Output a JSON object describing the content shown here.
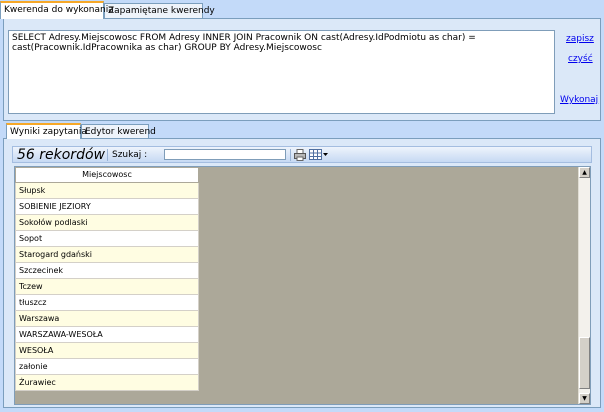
{
  "top_tabs": [
    "Kwerenda do wykonania",
    "Zapamiętane kwerendy"
  ],
  "query": {
    "text": "SELECT Adresy.Miejscowosc FROM Adresy INNER JOIN  Pracownik ON cast(Adresy.IdPodmiotu as char) = cast(Pracownik.IdPracownika as char) GROUP BY  Adresy.Miejscowosc",
    "save_label": "zapisz",
    "clear_label": "czyść",
    "run_label": "Wykonaj"
  },
  "result_tabs": [
    "Wyniki zapytania",
    "Edytor kwerend"
  ],
  "toolbar": {
    "record_count": "56 rekordów",
    "search_label": "Szukaj :",
    "search_value": ""
  },
  "grid": {
    "column_header": "Miejscowosc",
    "rows": [
      "Słupsk",
      "SOBIENIE JEZIORY",
      "Sokołów podlaski",
      "Sopot",
      "Starogard gdański",
      "Szczecinek",
      "Tczew",
      "tłuszcz",
      "Warszawa",
      "WARSZAWA-WESOŁA",
      "WESOŁA",
      "załonie",
      "Żurawiec"
    ]
  }
}
